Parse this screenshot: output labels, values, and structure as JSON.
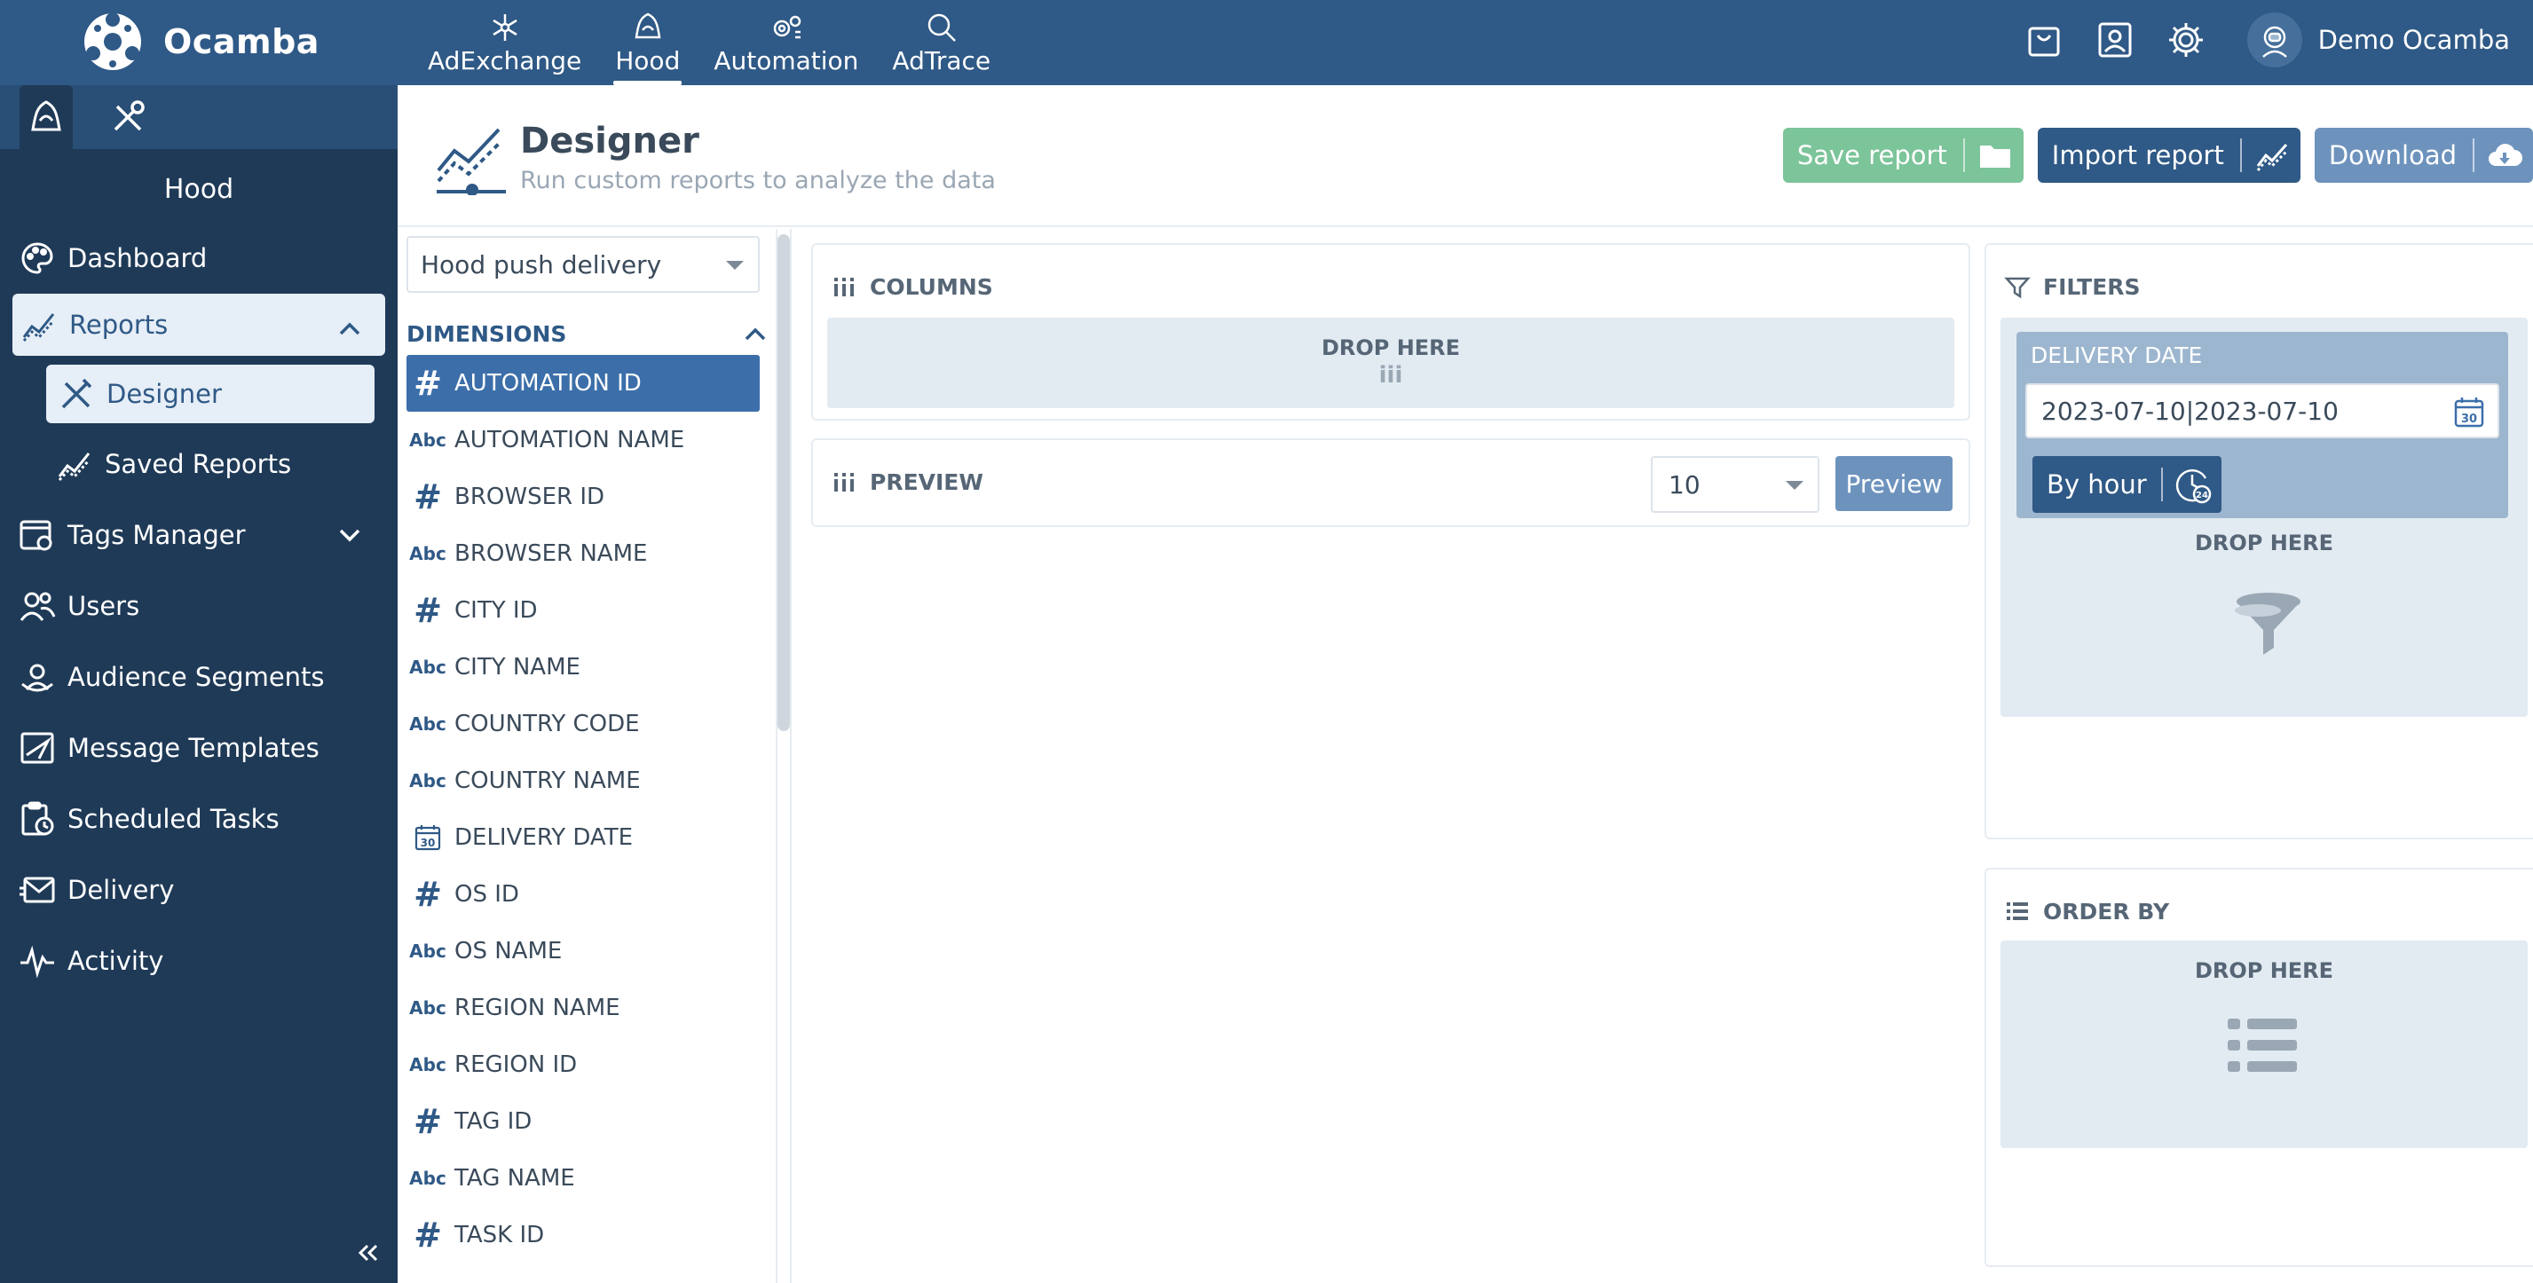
{
  "topbar": {
    "brand": "Ocamba",
    "nav": [
      {
        "label": "AdExchange",
        "icon": "snowflake-icon"
      },
      {
        "label": "Hood",
        "icon": "hood-icon"
      },
      {
        "label": "Automation",
        "icon": "gears-icon"
      },
      {
        "label": "AdTrace",
        "icon": "search-ad-icon"
      }
    ],
    "active_nav": "Hood",
    "user_name": "Demo Ocamba"
  },
  "sidebar": {
    "title": "Hood",
    "items": [
      {
        "label": "Dashboard",
        "icon": "palette-icon"
      },
      {
        "label": "Reports",
        "icon": "chart-line-icon"
      },
      {
        "label": "Tags Manager",
        "icon": "tag-window-icon"
      },
      {
        "label": "Users",
        "icon": "users-icon"
      },
      {
        "label": "Audience Segments",
        "icon": "audience-icon"
      },
      {
        "label": "Message Templates",
        "icon": "message-template-icon"
      },
      {
        "label": "Scheduled Tasks",
        "icon": "clipboard-clock-icon"
      },
      {
        "label": "Delivery",
        "icon": "envelope-icon"
      },
      {
        "label": "Activity",
        "icon": "pulse-icon"
      }
    ],
    "report_subitems": [
      {
        "label": "Designer",
        "icon": "pencil-ruler-icon"
      },
      {
        "label": "Saved Reports",
        "icon": "chart-line-icon"
      }
    ]
  },
  "header": {
    "title": "Designer",
    "subtitle": "Run custom reports to analyze the data",
    "buttons": {
      "save": "Save report",
      "import": "Import report",
      "download": "Download"
    }
  },
  "dimensions": {
    "source": "Hood push delivery",
    "header": "DIMENSIONS",
    "items": [
      {
        "label": "AUTOMATION ID",
        "type": "num"
      },
      {
        "label": "AUTOMATION NAME",
        "type": "abc"
      },
      {
        "label": "BROWSER ID",
        "type": "num"
      },
      {
        "label": "BROWSER NAME",
        "type": "abc"
      },
      {
        "label": "CITY ID",
        "type": "num"
      },
      {
        "label": "CITY NAME",
        "type": "abc"
      },
      {
        "label": "COUNTRY CODE",
        "type": "abc"
      },
      {
        "label": "COUNTRY NAME",
        "type": "abc"
      },
      {
        "label": "DELIVERY DATE",
        "type": "date"
      },
      {
        "label": "OS ID",
        "type": "num"
      },
      {
        "label": "OS NAME",
        "type": "abc"
      },
      {
        "label": "REGION NAME",
        "type": "abc"
      },
      {
        "label": "REGION ID",
        "type": "abc"
      },
      {
        "label": "TAG ID",
        "type": "num"
      },
      {
        "label": "TAG NAME",
        "type": "abc"
      },
      {
        "label": "TASK ID",
        "type": "num"
      }
    ],
    "type_labels": {
      "num": "#",
      "abc": "Abc",
      "date_day": "30"
    }
  },
  "columns": {
    "title": "COLUMNS",
    "drop_label": "DROP HERE",
    "drop_glyph": "iii"
  },
  "preview": {
    "title": "PREVIEW",
    "rows_value": "10",
    "button": "Preview"
  },
  "filters": {
    "title": "FILTERS",
    "filter_name": "DELIVERY DATE",
    "date_value": "2023-07-10|2023-07-10",
    "calendar_day": "30",
    "by_hour": "By hour",
    "drop_label": "DROP HERE"
  },
  "order_by": {
    "title": "ORDER BY",
    "drop_label": "DROP HERE"
  }
}
